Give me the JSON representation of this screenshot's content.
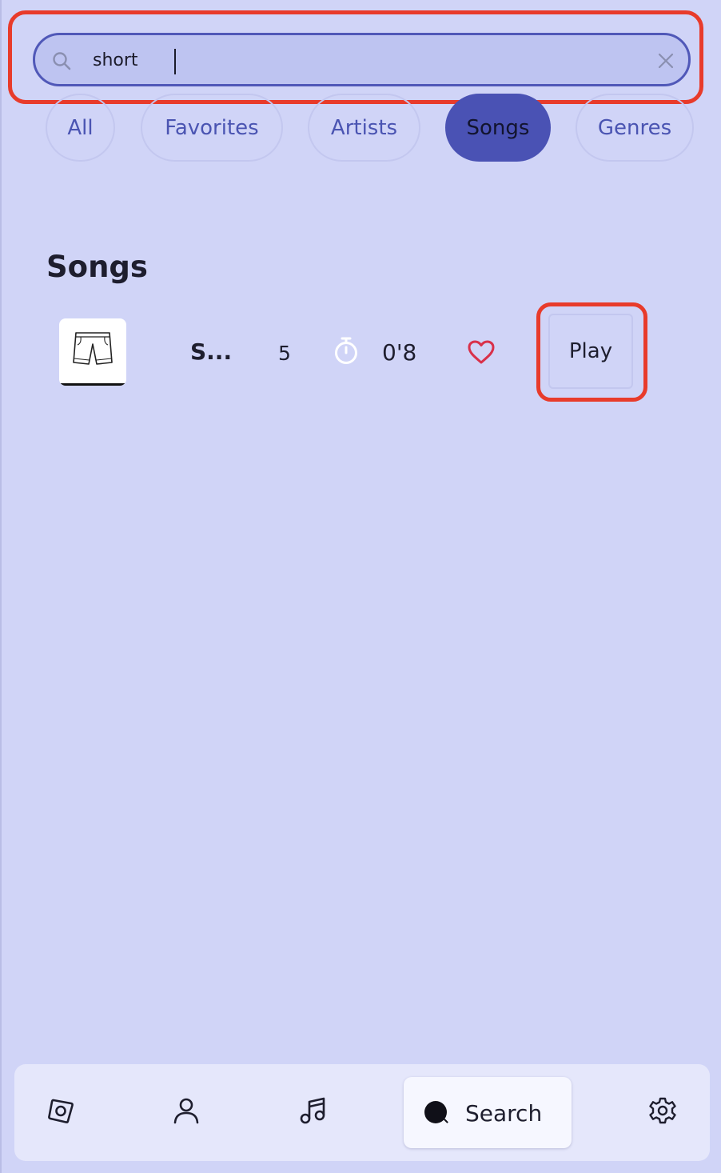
{
  "search": {
    "value": "short",
    "clear_icon": "close-icon",
    "search_icon": "search-icon"
  },
  "filters": {
    "all": "All",
    "favorites": "Favorites",
    "artists": "Artists",
    "songs": "Songs",
    "genres": "Genres",
    "active": "Songs"
  },
  "section": {
    "title": "Songs"
  },
  "songs": [
    {
      "thumbnail_icon": "shorts-icon",
      "title": "S...",
      "count": "5",
      "duration": "0'8",
      "favorite_icon": "heart-icon",
      "play_label": "Play"
    }
  ],
  "bottom_nav": {
    "items": [
      {
        "icon": "disc-icon"
      },
      {
        "icon": "user-icon"
      },
      {
        "icon": "music-note-icon"
      },
      {
        "icon": "search-icon",
        "label": "Search",
        "active": true
      },
      {
        "icon": "gear-icon"
      }
    ]
  },
  "colors": {
    "background": "#d0d4f7",
    "accent": "#4a52b4",
    "highlight": "#e83b2b",
    "heart": "#d9304a"
  }
}
